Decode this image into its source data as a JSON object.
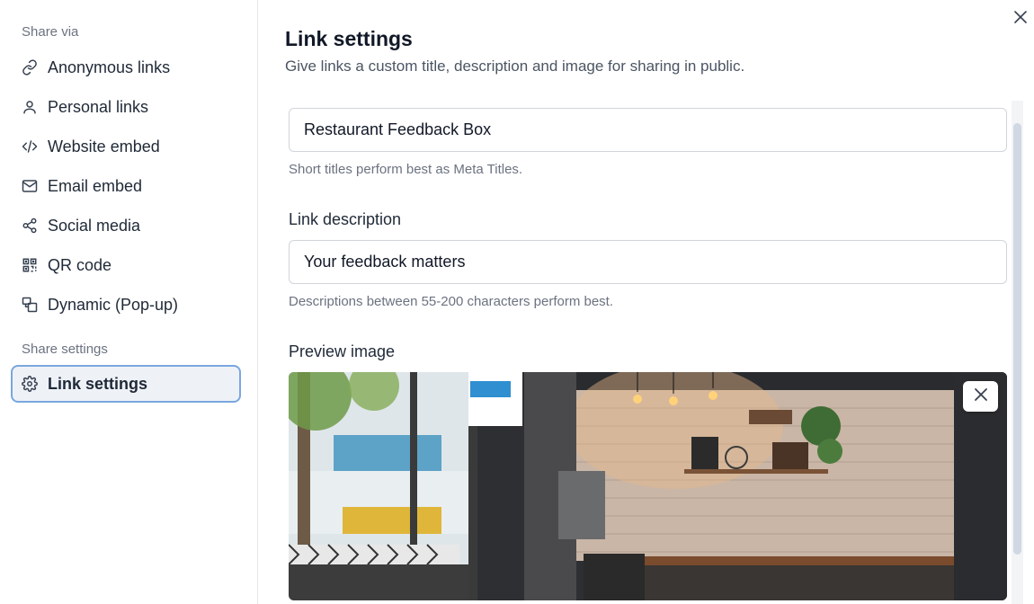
{
  "sidebar": {
    "share_via_label": "Share via",
    "share_settings_label": "Share settings",
    "items": [
      {
        "label": "Anonymous links",
        "icon": "link-icon"
      },
      {
        "label": "Personal links",
        "icon": "user-icon"
      },
      {
        "label": "Website embed",
        "icon": "code-icon"
      },
      {
        "label": "Email embed",
        "icon": "mail-icon"
      },
      {
        "label": "Social media",
        "icon": "share-icon"
      },
      {
        "label": "QR code",
        "icon": "qr-code-icon"
      },
      {
        "label": "Dynamic (Pop-up)",
        "icon": "popup-icon"
      }
    ],
    "settings_items": [
      {
        "label": "Link settings",
        "icon": "gear-icon",
        "active": true
      }
    ]
  },
  "main": {
    "title": "Link settings",
    "subtitle": "Give links a custom title, description and image for sharing in public.",
    "title_field": {
      "value": "Restaurant Feedback Box",
      "hint": "Short titles perform best as Meta Titles."
    },
    "description_field": {
      "label": "Link description",
      "value": "Your feedback matters",
      "hint": "Descriptions between 55-200 characters perform best."
    },
    "preview_image": {
      "label": "Preview image"
    }
  },
  "colors": {
    "active_border": "#7aa7de",
    "active_bg": "#eef2f7",
    "text": "#1f2937",
    "muted": "#6b7280"
  }
}
